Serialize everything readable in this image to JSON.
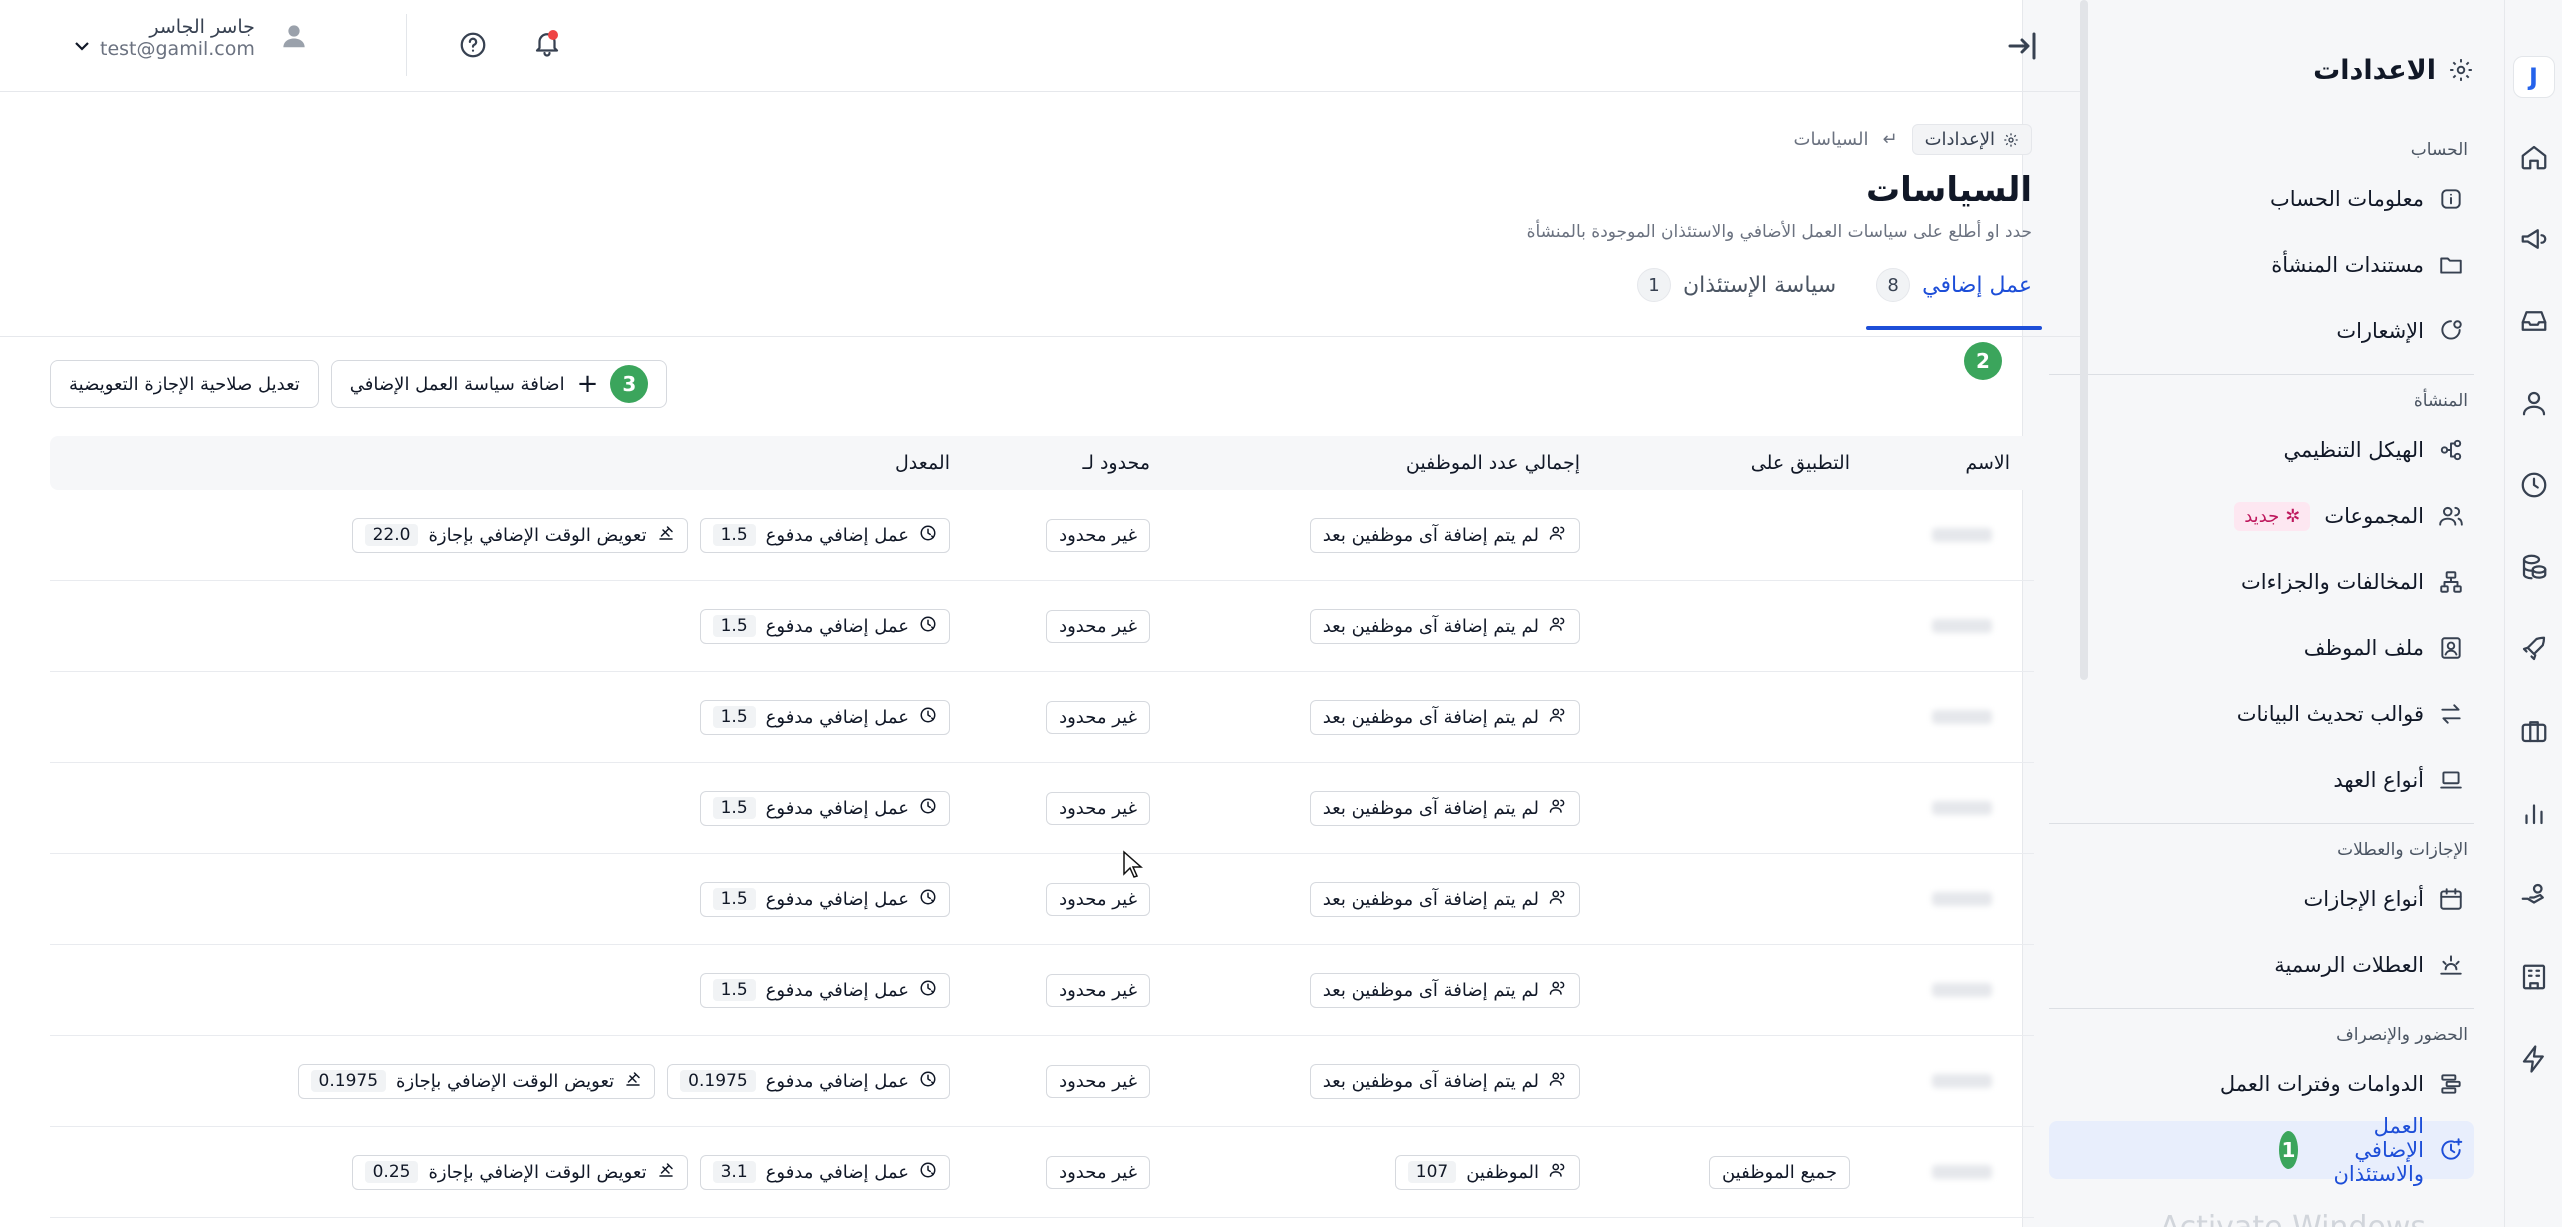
{
  "header": {
    "user_name": "جاسر الجاسر",
    "user_email": "test@gamil.com"
  },
  "sidebar": {
    "title": "الاعدادات",
    "sections": {
      "account": "الحساب",
      "org": "المنشأة",
      "leaves": "الإجازات والعطلات",
      "attendance": "الحضور والإنصراف"
    },
    "items": {
      "account_info": "معلومات الحساب",
      "org_docs": "مستندات المنشأة",
      "notifications": "الإشعارات",
      "org_structure": "الهيكل التنظيمي",
      "groups": "المجموعات",
      "violations": "المخالفات والجزاءات",
      "employee_file": "ملف الموظف",
      "data_templates": "قوالب تحديث البيانات",
      "custody_types": "أنواع العهد",
      "leave_types": "أنواع الإجازات",
      "holidays": "العطلات الرسمية",
      "shifts": "الدوامات وفترات العمل",
      "overtime": "العمل الإضافي والاستئذان"
    },
    "new_badge": "جديد",
    "watermark": "Activate Windows"
  },
  "steps": {
    "one": "1",
    "two": "2",
    "three": "3"
  },
  "breadcrumb": {
    "root": "الإعدادات",
    "current": "السياسات"
  },
  "page": {
    "title": "السياسات",
    "subtitle": "حدد او أطلع على سياسات العمل الأضافي والاستئذان الموجودة بالمنشأة"
  },
  "tabs": [
    {
      "label": "عمل إضافي",
      "count": "8"
    },
    {
      "label": "سياسة الإستئذان",
      "count": "1"
    }
  ],
  "toolbar": {
    "add_label": "اضافة سياسة العمل الإضافي",
    "edit_label": "تعديل صلاحية الإجازة التعويضية"
  },
  "table": {
    "headers": {
      "name": "الاسم",
      "apply": "التطبيق على",
      "total": "إجمالي عدد الموظفين",
      "limit": "محدود لـ",
      "rate": "المعدل"
    },
    "rows": [
      {
        "apply": "",
        "total": "لم يتم إضافة آى موظفين بعد",
        "total_count": "",
        "limit": "غير محدود",
        "paid_label": "عمل إضافي مدفوع",
        "paid_value": "1.5",
        "comp_label": "تعويض الوقت الإضافي بإجازة",
        "comp_value": "22.0"
      },
      {
        "apply": "",
        "total": "لم يتم إضافة آى موظفين بعد",
        "total_count": "",
        "limit": "غير محدود",
        "paid_label": "عمل إضافي مدفوع",
        "paid_value": "1.5",
        "comp_label": "",
        "comp_value": ""
      },
      {
        "apply": "",
        "total": "لم يتم إضافة آى موظفين بعد",
        "total_count": "",
        "limit": "غير محدود",
        "paid_label": "عمل إضافي مدفوع",
        "paid_value": "1.5",
        "comp_label": "",
        "comp_value": ""
      },
      {
        "apply": "",
        "total": "لم يتم إضافة آى موظفين بعد",
        "total_count": "",
        "limit": "غير محدود",
        "paid_label": "عمل إضافي مدفوع",
        "paid_value": "1.5",
        "comp_label": "",
        "comp_value": ""
      },
      {
        "apply": "",
        "total": "لم يتم إضافة آى موظفين بعد",
        "total_count": "",
        "limit": "غير محدود",
        "paid_label": "عمل إضافي مدفوع",
        "paid_value": "1.5",
        "comp_label": "",
        "comp_value": ""
      },
      {
        "apply": "",
        "total": "لم يتم إضافة آى موظفين بعد",
        "total_count": "",
        "limit": "غير محدود",
        "paid_label": "عمل إضافي مدفوع",
        "paid_value": "1.5",
        "comp_label": "",
        "comp_value": ""
      },
      {
        "apply": "",
        "total": "لم يتم إضافة آى موظفين بعد",
        "total_count": "",
        "limit": "غير محدود",
        "paid_label": "عمل إضافي مدفوع",
        "paid_value": "0.1975",
        "comp_label": "تعويض الوقت الإضافي بإجازة",
        "comp_value": "0.1975"
      },
      {
        "apply": "جميع الموظفين",
        "total": "الموظفين",
        "total_count": "107",
        "limit": "غير محدود",
        "paid_label": "عمل إضافي مدفوع",
        "paid_value": "3.1",
        "comp_label": "تعويض الوقت الإضافي بإجازة",
        "comp_value": "0.25"
      }
    ]
  }
}
